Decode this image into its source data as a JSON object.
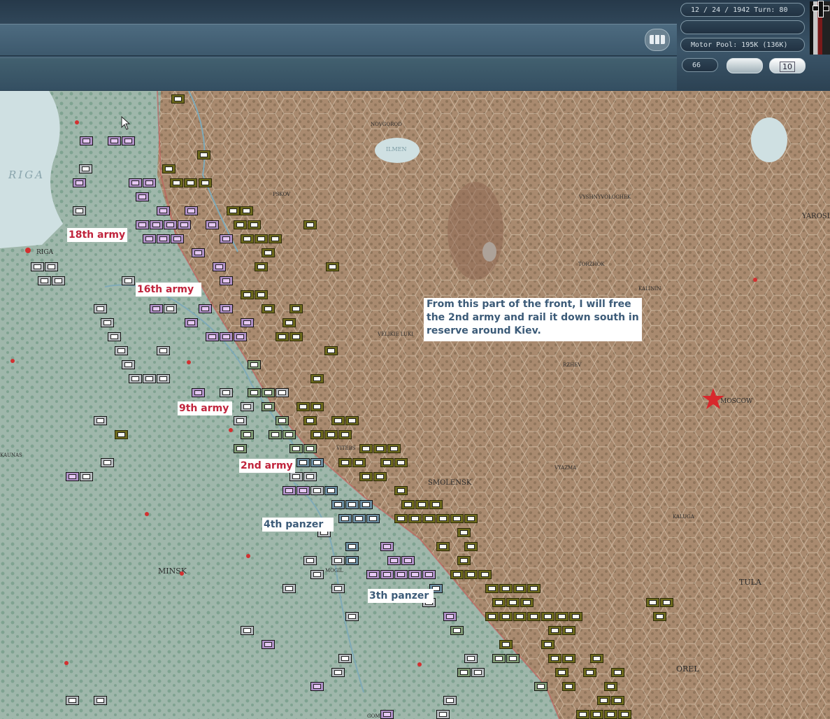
{
  "hud": {
    "date_turn": "12 / 24 / 1942     Turn: 80",
    "motor_pool": "Motor Pool:  195K (136K)",
    "counter_value": "66",
    "zoom_button_label": "10",
    "empty_slot": "",
    "stack_icon": "unit-stack-icon",
    "nation_flag_icon": "iron-cross-flag-icon"
  },
  "map": {
    "colors": {
      "axis_territory": "#9fb7ab",
      "soviet_territory": "#a98a6f",
      "sea": "#cfe0e2",
      "axis_counter": "#b090c8",
      "soviet_counter": "#6d6a1c"
    },
    "place_names": [
      "NOVGOROD",
      "ILMEN",
      "PSKOV",
      "VYSHNYVOLOCHEK",
      "YAROSL",
      "TORZHOK",
      "KALININ",
      "VELIKIE LUKI",
      "RZHEV",
      "MOSCOW",
      "VYAZMA",
      "SMOLENSK",
      "KALUGA",
      "TULA",
      "OREL",
      "MINSK",
      "KAUNAS",
      "RIGA",
      "GOMEL",
      "VITEBS",
      "MOGIL"
    ],
    "sea_name": "RIGA"
  },
  "annotations": {
    "army18": "18th army",
    "army16": "16th army",
    "army9": "9th army",
    "army2": "2nd army",
    "panzer4": "4th panzer",
    "panzer3": "3th panzer",
    "note": "From this part of the front, I will free the 2nd army and rail it down south in reserve around Kiev."
  }
}
